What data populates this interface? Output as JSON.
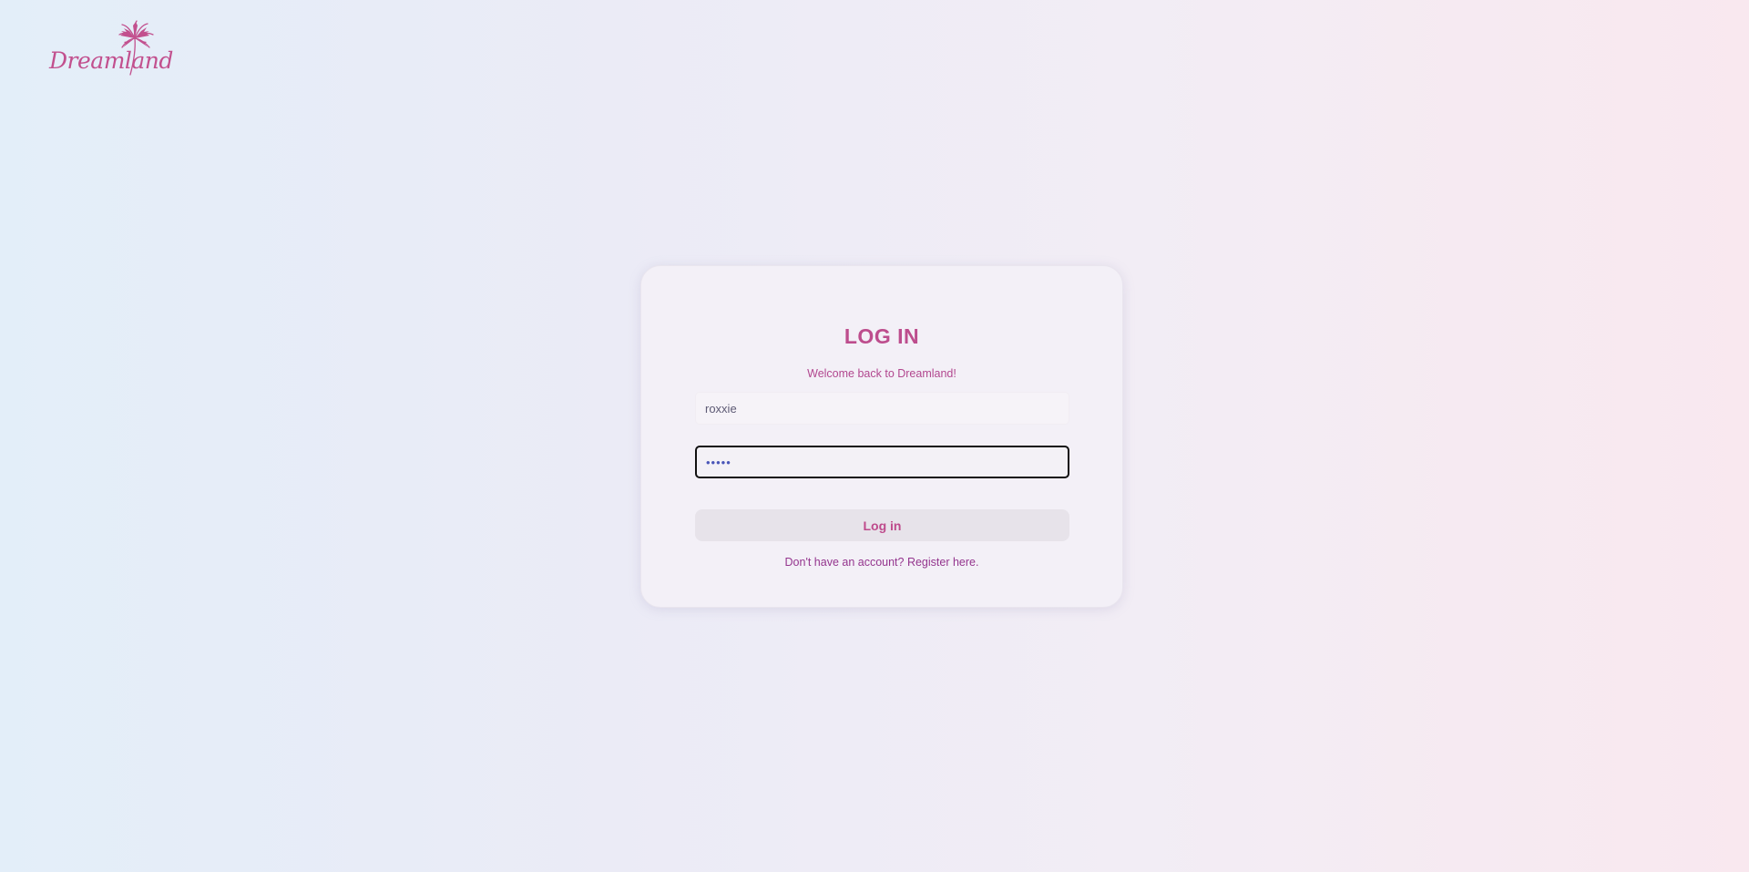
{
  "brand": {
    "name": "Dreamland",
    "logo_icon": "palm-tree-icon",
    "color": "#c2508e"
  },
  "login": {
    "title": "LOG IN",
    "subtitle": "Welcome back to Dreamland!",
    "username_value": "roxxie",
    "password_value": "•••••",
    "submit_label": "Log in",
    "register_text": "Don't have an account? Register here."
  },
  "colors": {
    "accent": "#bd4d8d",
    "link": "#94358e",
    "card_bg": "#f3f0f7",
    "focus_border": "#111111"
  }
}
